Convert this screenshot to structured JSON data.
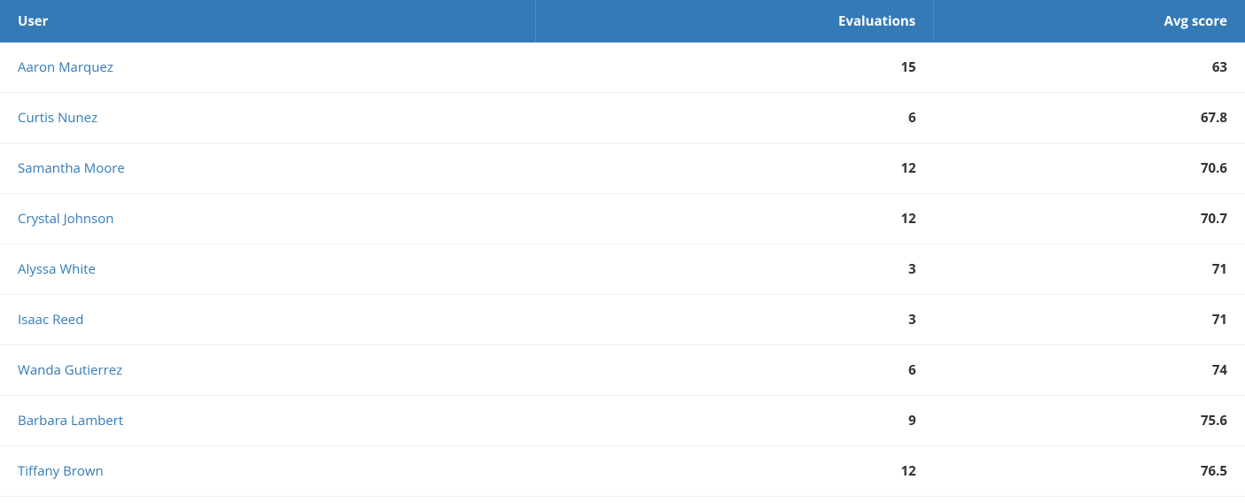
{
  "table": {
    "headers": {
      "user": "User",
      "evaluations": "Evaluations",
      "avg_score": "Avg score"
    },
    "rows": [
      {
        "user": "Aaron Marquez",
        "evaluations": "15",
        "avg_score": "63"
      },
      {
        "user": "Curtis Nunez",
        "evaluations": "6",
        "avg_score": "67.8"
      },
      {
        "user": "Samantha Moore",
        "evaluations": "12",
        "avg_score": "70.6"
      },
      {
        "user": "Crystal Johnson",
        "evaluations": "12",
        "avg_score": "70.7"
      },
      {
        "user": "Alyssa White",
        "evaluations": "3",
        "avg_score": "71"
      },
      {
        "user": "Isaac Reed",
        "evaluations": "3",
        "avg_score": "71"
      },
      {
        "user": "Wanda Gutierrez",
        "evaluations": "6",
        "avg_score": "74"
      },
      {
        "user": "Barbara Lambert",
        "evaluations": "9",
        "avg_score": "75.6"
      },
      {
        "user": "Tiffany Brown",
        "evaluations": "12",
        "avg_score": "76.5"
      }
    ]
  }
}
